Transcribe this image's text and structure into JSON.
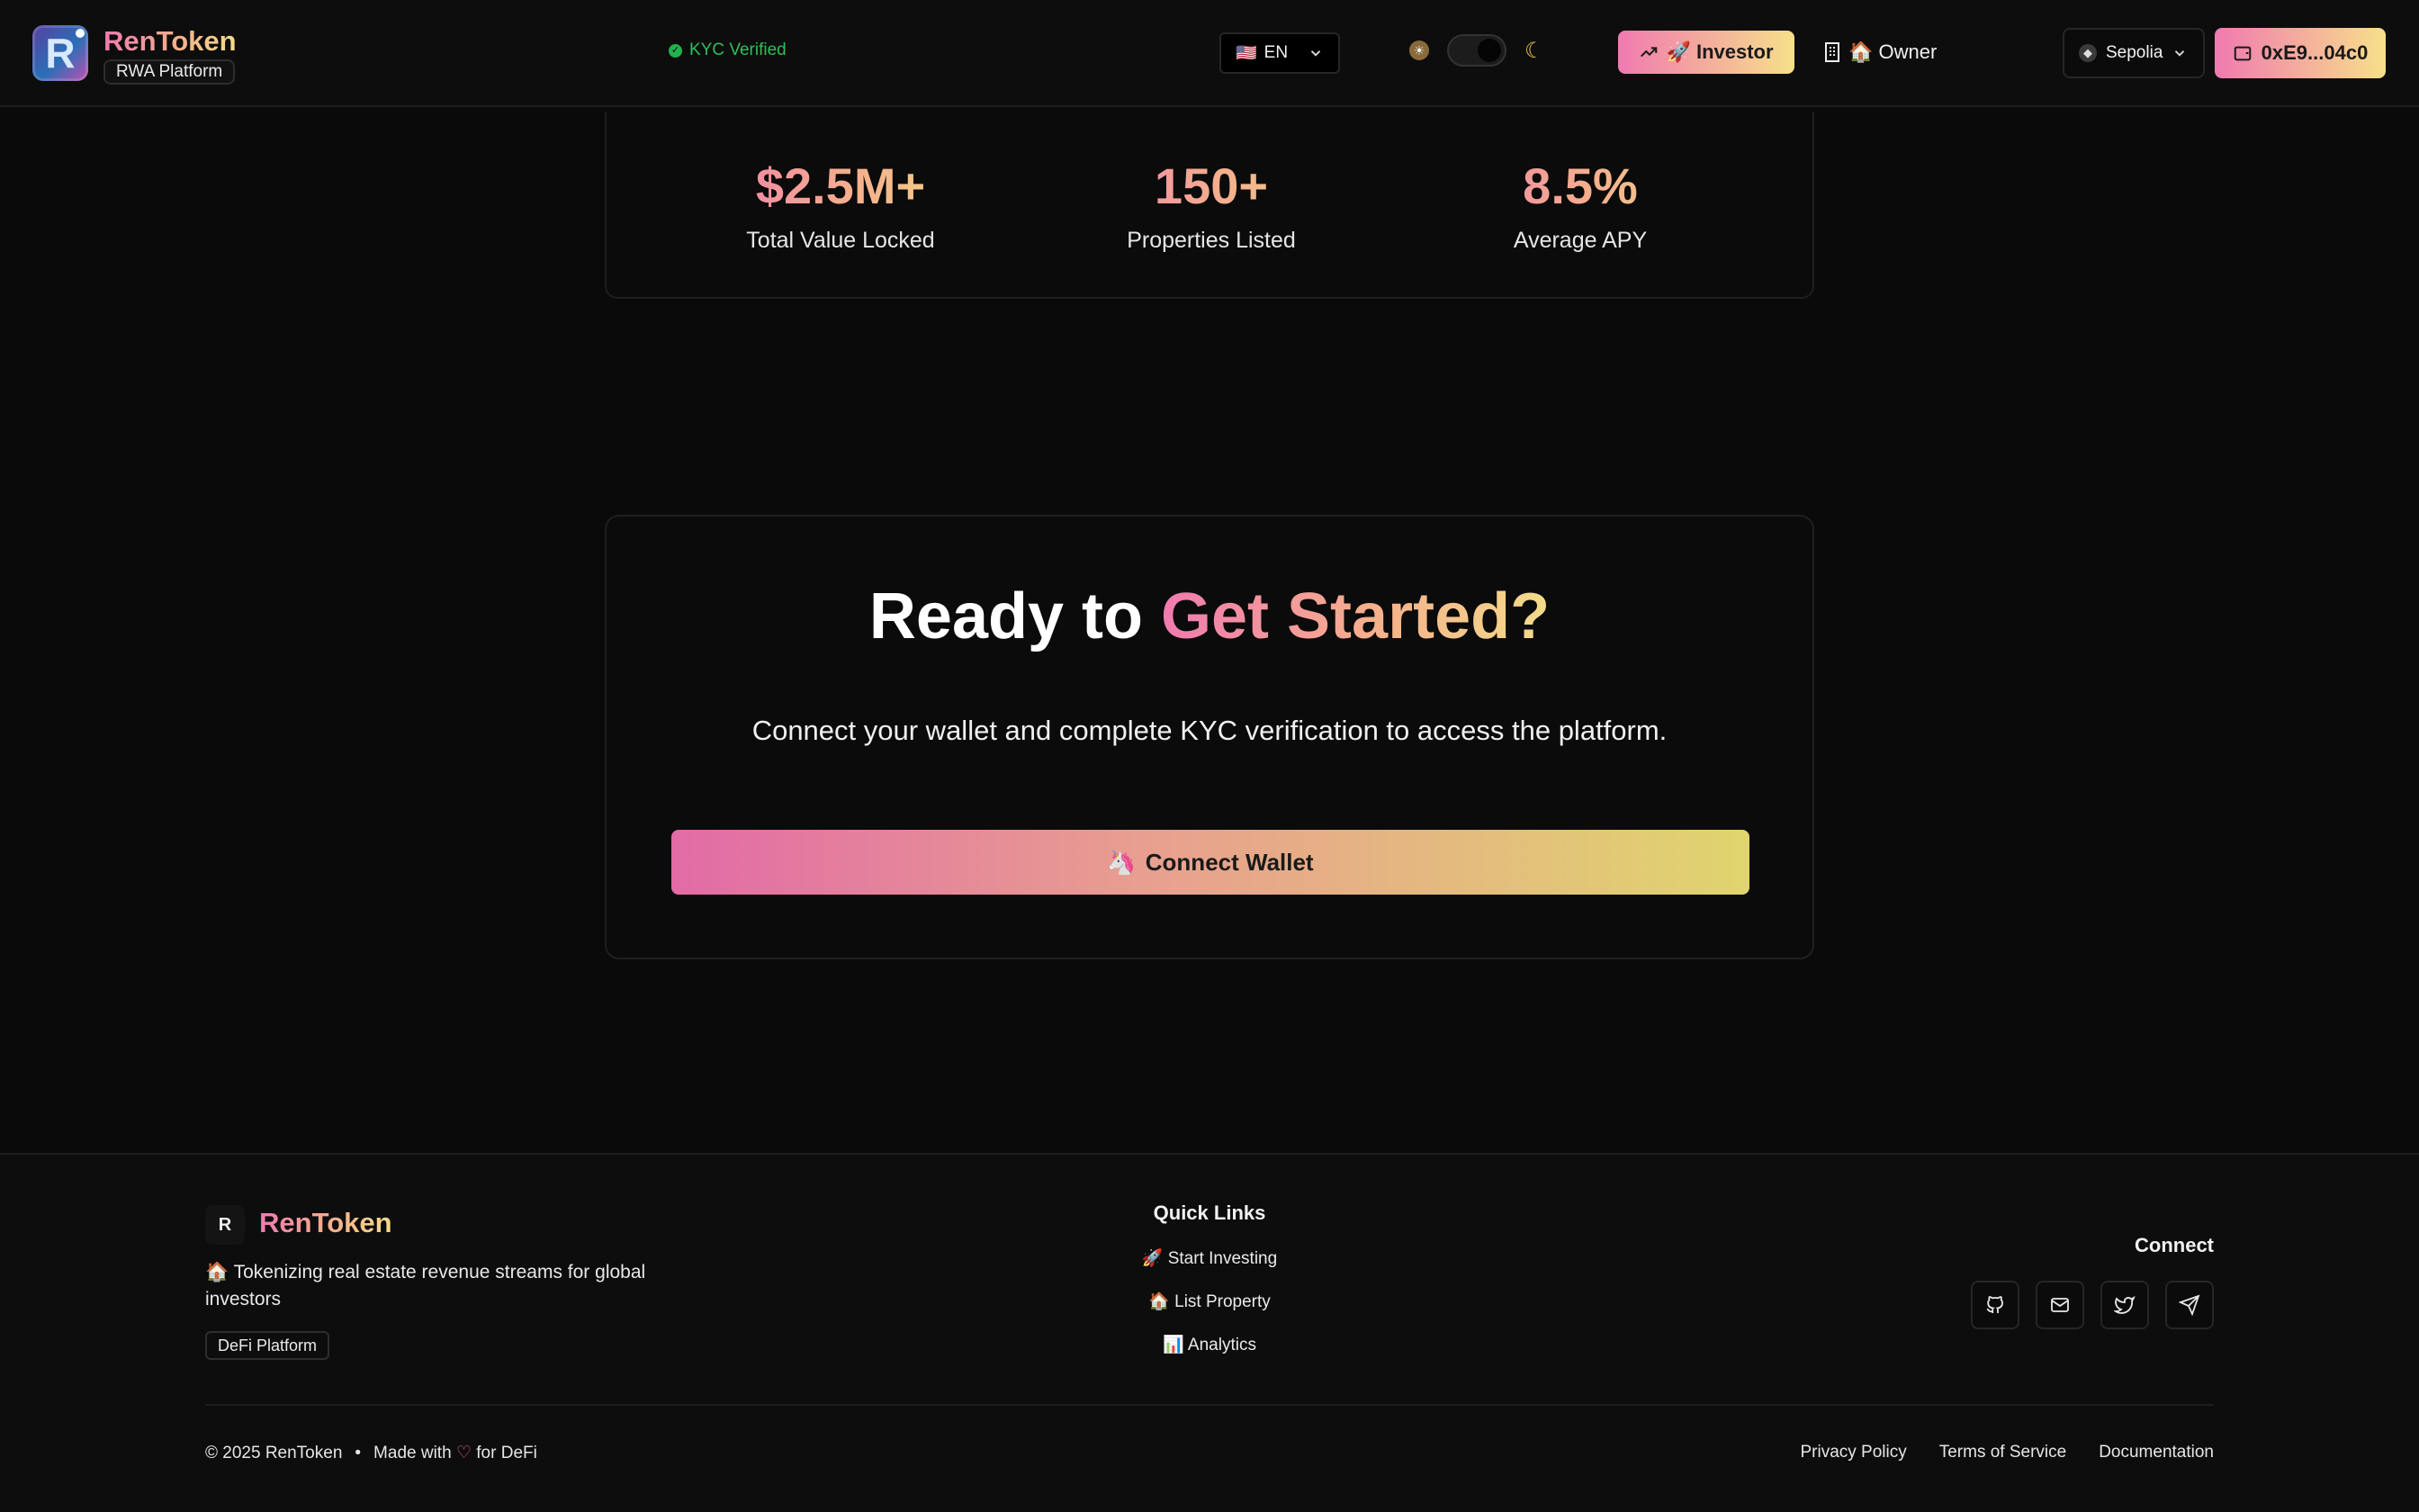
{
  "header": {
    "brand": "RenToken",
    "brand_sub": "RWA Platform",
    "logo_letter": "R",
    "kyc_status": "KYC Verified",
    "language": {
      "flag": "🇺🇸",
      "code": "EN"
    },
    "theme": {
      "light_icon": "sun-icon",
      "dark_icon": "moon-icon",
      "mode": "dark"
    },
    "roles": {
      "investor_label": "🚀 Investor",
      "owner_label": "🏠 Owner",
      "active": "investor"
    },
    "network": "Sepolia",
    "wallet_address": "0xE9...04c0"
  },
  "stats": [
    {
      "value": "$2.5M+",
      "label": "Total Value Locked"
    },
    {
      "value": "150+",
      "label": "Properties Listed"
    },
    {
      "value": "8.5%",
      "label": "Average APY"
    }
  ],
  "cta": {
    "title_plain": "Ready to",
    "title_highlight": "Get Started?",
    "description": "Connect your wallet and complete KYC verification to access the platform.",
    "button_label": "Connect Wallet",
    "button_emoji": "🦄"
  },
  "footer": {
    "logo_letter": "R",
    "brand": "RenToken",
    "tagline": "🏠 Tokenizing real estate revenue streams for global investors",
    "badge": "DeFi Platform",
    "quick_links_title": "Quick Links",
    "quick_links": [
      "🚀 Start Investing",
      "🏠 List Property",
      "📊 Analytics"
    ],
    "connect_title": "Connect",
    "social_icons": [
      "github-icon",
      "mail-icon",
      "twitter-icon",
      "telegram-icon"
    ],
    "copyright": "© 2025 RenToken",
    "separator": "•",
    "made_with_pre": "Made with",
    "made_with_post": "for DeFi",
    "legal_links": [
      "Privacy Policy",
      "Terms of Service",
      "Documentation"
    ]
  },
  "colors": {
    "accent_pink": "#f07ab0",
    "accent_yellow": "#f7e08a",
    "kyc_green": "#2fbf5a",
    "background": "#0a0a0a"
  }
}
